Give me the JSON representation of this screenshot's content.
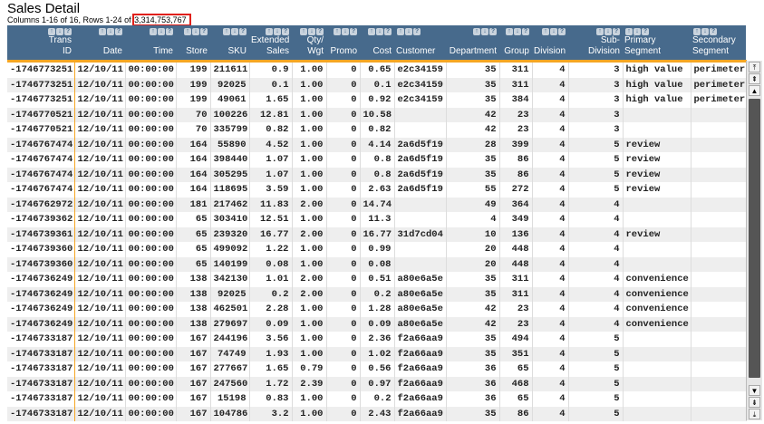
{
  "title": "Sales Detail",
  "summary_prefix": "Columns 1-16 of 16,  Rows 1-24 of ",
  "total_rows": "3,314,753,767",
  "header_icons": {
    "sort_asc": "↑",
    "sort_desc": "↓",
    "help": "?"
  },
  "columns": [
    {
      "label": "Trans ID",
      "align": "right"
    },
    {
      "label": "Date",
      "align": "right"
    },
    {
      "label": "Time",
      "align": "right"
    },
    {
      "label": "Store",
      "align": "right"
    },
    {
      "label": "SKU",
      "align": "right"
    },
    {
      "label": "Extended Sales",
      "align": "right"
    },
    {
      "label": "Qty/ Wgt",
      "align": "right"
    },
    {
      "label": "Promo",
      "align": "right"
    },
    {
      "label": "Cost",
      "align": "right"
    },
    {
      "label": "Customer",
      "align": "left"
    },
    {
      "label": "Department",
      "align": "right"
    },
    {
      "label": "Group",
      "align": "right"
    },
    {
      "label": "Division",
      "align": "right"
    },
    {
      "label": "Sub-Division",
      "align": "right"
    },
    {
      "label": "Primary Segment",
      "align": "left"
    },
    {
      "label": "Secondary Segment",
      "align": "left"
    }
  ],
  "rows": [
    [
      "-1746773251",
      "12/10/11",
      "00:00:00",
      "199",
      "211611",
      "0.9",
      "1.00",
      "0",
      "0.65",
      "e2c34159",
      "35",
      "311",
      "4",
      "3",
      "high value",
      "perimeter"
    ],
    [
      "-1746773251",
      "12/10/11",
      "00:00:00",
      "199",
      "92025",
      "0.1",
      "1.00",
      "0",
      "0.1",
      "e2c34159",
      "35",
      "311",
      "4",
      "3",
      "high value",
      "perimeter"
    ],
    [
      "-1746773251",
      "12/10/11",
      "00:00:00",
      "199",
      "49061",
      "1.65",
      "1.00",
      "0",
      "0.92",
      "e2c34159",
      "35",
      "384",
      "4",
      "3",
      "high value",
      "perimeter"
    ],
    [
      "-1746770521",
      "12/10/11",
      "00:00:00",
      "70",
      "100226",
      "12.81",
      "1.00",
      "0",
      "10.58",
      "",
      "42",
      "23",
      "4",
      "3",
      "",
      ""
    ],
    [
      "-1746770521",
      "12/10/11",
      "00:00:00",
      "70",
      "335799",
      "0.82",
      "1.00",
      "0",
      "0.82",
      "",
      "42",
      "23",
      "4",
      "3",
      "",
      ""
    ],
    [
      "-1746767474",
      "12/10/11",
      "00:00:00",
      "164",
      "55890",
      "4.52",
      "1.00",
      "0",
      "4.14",
      "2a6d5f19",
      "28",
      "399",
      "4",
      "5",
      "review",
      ""
    ],
    [
      "-1746767474",
      "12/10/11",
      "00:00:00",
      "164",
      "398440",
      "1.07",
      "1.00",
      "0",
      "0.8",
      "2a6d5f19",
      "35",
      "86",
      "4",
      "5",
      "review",
      ""
    ],
    [
      "-1746767474",
      "12/10/11",
      "00:00:00",
      "164",
      "305295",
      "1.07",
      "1.00",
      "0",
      "0.8",
      "2a6d5f19",
      "35",
      "86",
      "4",
      "5",
      "review",
      ""
    ],
    [
      "-1746767474",
      "12/10/11",
      "00:00:00",
      "164",
      "118695",
      "3.59",
      "1.00",
      "0",
      "2.63",
      "2a6d5f19",
      "55",
      "272",
      "4",
      "5",
      "review",
      ""
    ],
    [
      "-1746762972",
      "12/10/11",
      "00:00:00",
      "181",
      "217462",
      "11.83",
      "2.00",
      "0",
      "14.74",
      "",
      "49",
      "364",
      "4",
      "4",
      "",
      ""
    ],
    [
      "-1746739362",
      "12/10/11",
      "00:00:00",
      "65",
      "303410",
      "12.51",
      "1.00",
      "0",
      "11.3",
      "",
      "4",
      "349",
      "4",
      "4",
      "",
      ""
    ],
    [
      "-1746739361",
      "12/10/11",
      "00:00:00",
      "65",
      "239320",
      "16.77",
      "2.00",
      "0",
      "16.77",
      "31d7cd04",
      "10",
      "136",
      "4",
      "4",
      "review",
      ""
    ],
    [
      "-1746739360",
      "12/10/11",
      "00:00:00",
      "65",
      "499092",
      "1.22",
      "1.00",
      "0",
      "0.99",
      "",
      "20",
      "448",
      "4",
      "4",
      "",
      ""
    ],
    [
      "-1746739360",
      "12/10/11",
      "00:00:00",
      "65",
      "140199",
      "0.08",
      "1.00",
      "0",
      "0.08",
      "",
      "20",
      "448",
      "4",
      "4",
      "",
      ""
    ],
    [
      "-1746736249",
      "12/10/11",
      "00:00:00",
      "138",
      "342130",
      "1.01",
      "2.00",
      "0",
      "0.51",
      "a80e6a5e",
      "35",
      "311",
      "4",
      "4",
      "convenience",
      ""
    ],
    [
      "-1746736249",
      "12/10/11",
      "00:00:00",
      "138",
      "92025",
      "0.2",
      "2.00",
      "0",
      "0.2",
      "a80e6a5e",
      "35",
      "311",
      "4",
      "4",
      "convenience",
      ""
    ],
    [
      "-1746736249",
      "12/10/11",
      "00:00:00",
      "138",
      "462501",
      "2.28",
      "1.00",
      "0",
      "1.28",
      "a80e6a5e",
      "42",
      "23",
      "4",
      "4",
      "convenience",
      ""
    ],
    [
      "-1746736249",
      "12/10/11",
      "00:00:00",
      "138",
      "279697",
      "0.09",
      "1.00",
      "0",
      "0.09",
      "a80e6a5e",
      "42",
      "23",
      "4",
      "4",
      "convenience",
      ""
    ],
    [
      "-1746733187",
      "12/10/11",
      "00:00:00",
      "167",
      "244196",
      "3.56",
      "1.00",
      "0",
      "2.36",
      "f2a66aa9",
      "35",
      "494",
      "4",
      "5",
      "",
      ""
    ],
    [
      "-1746733187",
      "12/10/11",
      "00:00:00",
      "167",
      "74749",
      "1.93",
      "1.00",
      "0",
      "1.02",
      "f2a66aa9",
      "35",
      "351",
      "4",
      "5",
      "",
      ""
    ],
    [
      "-1746733187",
      "12/10/11",
      "00:00:00",
      "167",
      "277667",
      "1.65",
      "0.79",
      "0",
      "0.56",
      "f2a66aa9",
      "36",
      "65",
      "4",
      "5",
      "",
      ""
    ],
    [
      "-1746733187",
      "12/10/11",
      "00:00:00",
      "167",
      "247560",
      "1.72",
      "2.39",
      "0",
      "0.97",
      "f2a66aa9",
      "36",
      "468",
      "4",
      "5",
      "",
      ""
    ],
    [
      "-1746733187",
      "12/10/11",
      "00:00:00",
      "167",
      "15198",
      "0.83",
      "1.00",
      "0",
      "0.2",
      "f2a66aa9",
      "36",
      "65",
      "4",
      "5",
      "",
      ""
    ],
    [
      "-1746733187",
      "12/10/11",
      "00:00:00",
      "167",
      "104786",
      "3.2",
      "1.00",
      "0",
      "2.43",
      "f2a66aa9",
      "35",
      "86",
      "4",
      "5",
      "",
      ""
    ]
  ],
  "scrollbar": {
    "top": "⤒",
    "page_up": "⇞",
    "up": "▲",
    "down": "▼",
    "page_down": "⇟",
    "bottom": "⤓"
  },
  "colors": {
    "header": "#476a8c",
    "accent": "#f5a623",
    "highlight": "#e0201a"
  }
}
